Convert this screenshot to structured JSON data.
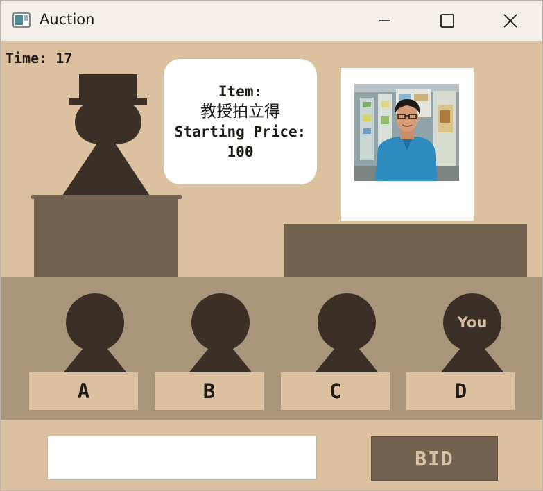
{
  "window": {
    "title": "Auction",
    "app_icon": "window-app-icon",
    "controls": [
      "minimize-icon",
      "maximize-icon",
      "close-icon"
    ]
  },
  "timer": {
    "text": "Time: 17"
  },
  "item_card": {
    "line1": "Item:",
    "item_name": "教授拍立得",
    "line3": "Starting Price:",
    "price": "100"
  },
  "bidders": [
    {
      "label": "A",
      "head_text": ""
    },
    {
      "label": "B",
      "head_text": ""
    },
    {
      "label": "C",
      "head_text": ""
    },
    {
      "label": "D",
      "head_text": "You"
    }
  ],
  "bid_form": {
    "input_value": "",
    "input_placeholder": "",
    "button_label": "BID"
  },
  "colors": {
    "background": "#dbc19f",
    "floor": "#a8957a",
    "furniture": "#73614f",
    "figure": "#3a3028",
    "card": "#ffffff"
  }
}
